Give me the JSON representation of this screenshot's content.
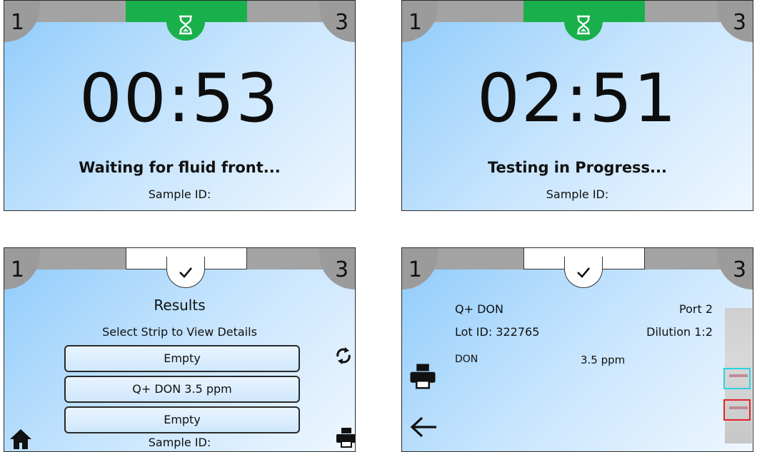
{
  "screens": [
    {
      "left_port": "1",
      "right_port": "3",
      "tab_icon": "hourglass-icon",
      "timer": "00:53",
      "status": "Waiting for fluid front...",
      "sample_label": "Sample ID:"
    },
    {
      "left_port": "1",
      "right_port": "3",
      "tab_icon": "hourglass-icon",
      "timer": "02:51",
      "status": "Testing in Progress...",
      "sample_label": "Sample ID:"
    },
    {
      "left_port": "1",
      "right_port": "3",
      "tab_icon": "checkmark-icon",
      "title": "Results",
      "subtitle": "Select Strip to View Details",
      "strips": [
        "Empty",
        "Q+ DON 3.5 ppm",
        "Empty"
      ],
      "sample_label": "Sample ID:",
      "icons": [
        "refresh-icon",
        "home-icon",
        "printer-icon"
      ]
    },
    {
      "left_port": "1",
      "right_port": "3",
      "tab_icon": "checkmark-icon",
      "test_name": "Q+ DON",
      "port": "Port 2",
      "lot_id": "Lot ID: 322765",
      "dilution": "Dilution 1:2",
      "analyte": "DON",
      "result": "3.5 ppm",
      "icons": [
        "printer-icon",
        "back-arrow-icon"
      ]
    }
  ],
  "colors": {
    "active_tab_running": "#19b04b",
    "active_tab_done": "#ffffff",
    "tab_band": "#a3a3a3",
    "control_line_box": "#2ad3e0",
    "test_line_box": "#e4222b"
  }
}
